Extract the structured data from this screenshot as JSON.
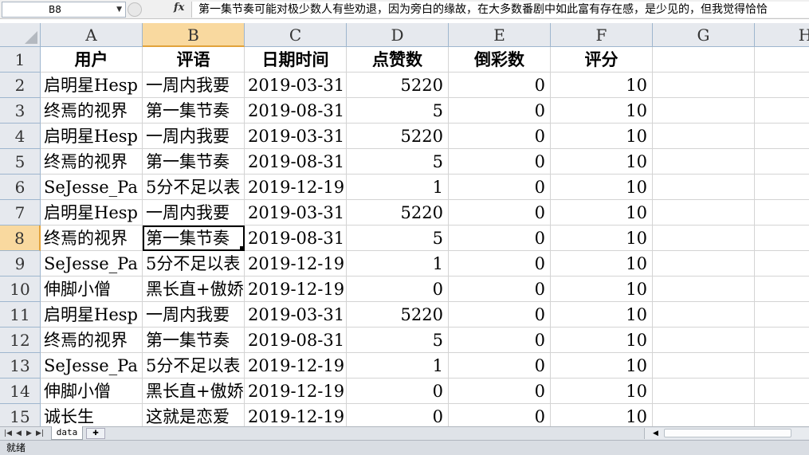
{
  "formula_bar": {
    "name_box": "B8",
    "name_box_arrow": "▼",
    "fx_label": "fx",
    "formula": "第一集节奏可能对极少数人有些劝退，因为旁白的缘故，在大多数番剧中如此富有存在感，是少见的，但我觉得恰恰"
  },
  "columns": [
    "A",
    "B",
    "C",
    "D",
    "E",
    "F",
    "G",
    "H"
  ],
  "selected_column": "B",
  "selected_row": "8",
  "header_row": {
    "row": "1",
    "cells": [
      "用户",
      "评语",
      "日期时间",
      "点赞数",
      "倒彩数",
      "评分"
    ]
  },
  "rows": [
    {
      "row": "2",
      "user": "启明星Hesp",
      "comment": "一周内我要",
      "date": "2019-03-31",
      "likes": "5220",
      "dislikes": "0",
      "score": "10"
    },
    {
      "row": "3",
      "user": "终焉的视界",
      "comment": "第一集节奏",
      "date": "2019-08-31",
      "likes": "5",
      "dislikes": "0",
      "score": "10"
    },
    {
      "row": "4",
      "user": "启明星Hesp",
      "comment": "一周内我要",
      "date": "2019-03-31",
      "likes": "5220",
      "dislikes": "0",
      "score": "10"
    },
    {
      "row": "5",
      "user": "终焉的视界",
      "comment": "第一集节奏",
      "date": "2019-08-31",
      "likes": "5",
      "dislikes": "0",
      "score": "10"
    },
    {
      "row": "6",
      "user": "SeJesse_Pa",
      "comment": "5分不足以表",
      "date": "2019-12-19",
      "likes": "1",
      "dislikes": "0",
      "score": "10"
    },
    {
      "row": "7",
      "user": "启明星Hesp",
      "comment": "一周内我要",
      "date": "2019-03-31",
      "likes": "5220",
      "dislikes": "0",
      "score": "10"
    },
    {
      "row": "8",
      "user": "终焉的视界",
      "comment": "第一集节奏",
      "date": "2019-08-31",
      "likes": "5",
      "dislikes": "0",
      "score": "10"
    },
    {
      "row": "9",
      "user": "SeJesse_Pa",
      "comment": "5分不足以表",
      "date": "2019-12-19",
      "likes": "1",
      "dislikes": "0",
      "score": "10"
    },
    {
      "row": "10",
      "user": "伸脚小僧",
      "comment": "黑长直+傲娇",
      "date": "2019-12-19",
      "likes": "0",
      "dislikes": "0",
      "score": "10"
    },
    {
      "row": "11",
      "user": "启明星Hesp",
      "comment": "一周内我要",
      "date": "2019-03-31",
      "likes": "5220",
      "dislikes": "0",
      "score": "10"
    },
    {
      "row": "12",
      "user": "终焉的视界",
      "comment": "第一集节奏",
      "date": "2019-08-31",
      "likes": "5",
      "dislikes": "0",
      "score": "10"
    },
    {
      "row": "13",
      "user": "SeJesse_Pa",
      "comment": "5分不足以表",
      "date": "2019-12-19",
      "likes": "1",
      "dislikes": "0",
      "score": "10"
    },
    {
      "row": "14",
      "user": "伸脚小僧",
      "comment": "黑长直+傲娇",
      "date": "2019-12-19",
      "likes": "0",
      "dislikes": "0",
      "score": "10"
    },
    {
      "row": "15",
      "user": "诚长生",
      "comment": "这就是恋爱",
      "date": "2019-12-19",
      "likes": "0",
      "dislikes": "0",
      "score": "10"
    }
  ],
  "sheet_tabs": [
    "data"
  ],
  "status": "就绪"
}
